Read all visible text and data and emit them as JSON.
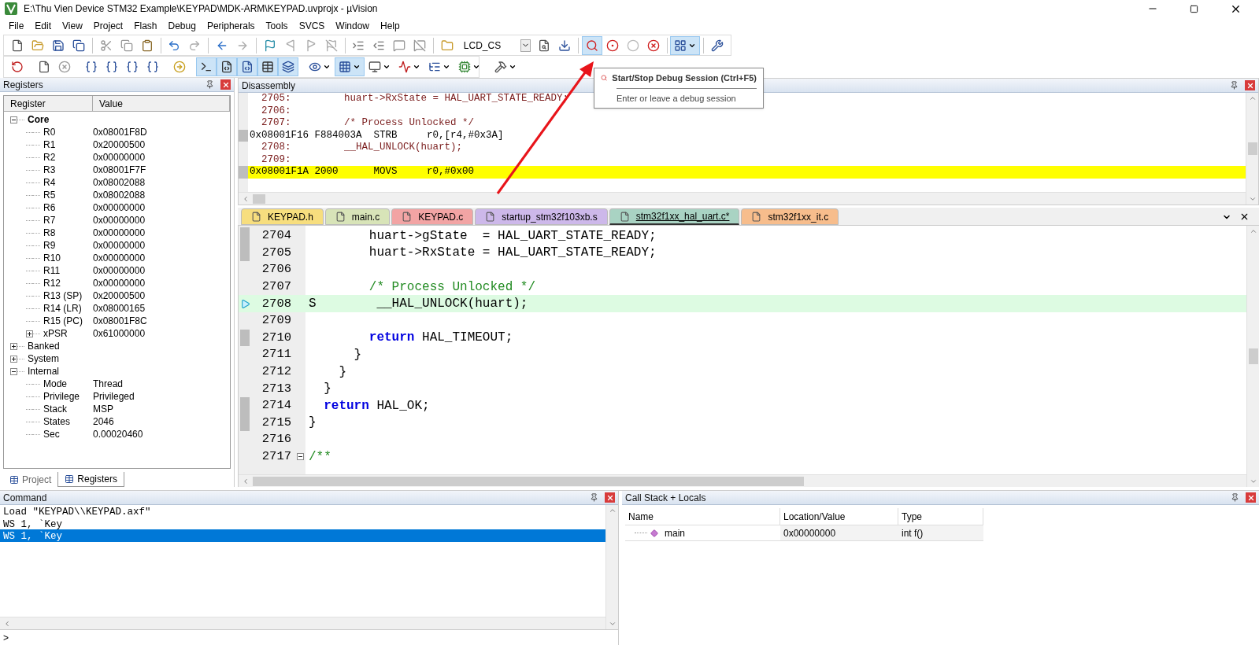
{
  "window": {
    "title": "E:\\Thu Vien Device STM32 Example\\KEYPAD\\MDK-ARM\\KEYPAD.uvprojx - µVision"
  },
  "menu": [
    "File",
    "Edit",
    "View",
    "Project",
    "Flash",
    "Debug",
    "Peripherals",
    "Tools",
    "SVCS",
    "Window",
    "Help"
  ],
  "toolbar_1": {
    "target": "LCD_CS",
    "buttons": [
      {
        "pressed": false
      },
      {
        "pressed": false
      },
      {
        "pressed": false
      },
      {
        "pressed": false
      },
      {
        "pressed": false
      },
      {
        "pressed": false
      },
      {
        "pressed": false
      },
      {
        "pressed": false
      },
      {
        "pressed": false
      },
      {
        "pressed": false
      },
      {
        "pressed": false
      },
      {
        "pressed": false
      },
      {
        "pressed": false
      },
      {
        "pressed": false
      },
      {
        "pressed": false
      },
      {
        "pressed": false
      },
      {
        "pressed": false
      },
      {
        "pressed": false
      },
      {
        "pressed": false
      },
      {
        "pressed": false
      },
      {
        "pressed": false
      },
      {
        "pressed": false
      },
      {
        "pressed": true
      },
      {
        "pressed": false
      },
      {
        "pressed": false
      },
      {
        "pressed": false
      },
      {
        "pressed": true
      },
      {
        "pressed": false
      }
    ]
  },
  "toolbar_2": {
    "buttons": [
      {
        "pressed": false
      },
      {
        "pressed": false
      },
      {
        "pressed": false
      },
      {
        "pressed": false
      },
      {
        "pressed": false
      },
      {
        "pressed": false
      },
      {
        "pressed": false
      },
      {
        "pressed": false
      },
      {
        "pressed": true
      },
      {
        "pressed": true
      },
      {
        "pressed": true
      },
      {
        "pressed": true
      },
      {
        "pressed": true
      },
      {
        "pressed": false
      },
      {
        "pressed": true
      },
      {
        "pressed": false
      },
      {
        "pressed": false
      },
      {
        "pressed": false
      },
      {
        "pressed": false
      },
      {
        "pressed": false
      }
    ]
  },
  "tooltip": {
    "title": "Start/Stop Debug Session (Ctrl+F5)",
    "description": "Enter or leave a debug session"
  },
  "registers": {
    "title": "Registers",
    "columns": [
      "Register",
      "Value"
    ],
    "tree": [
      {
        "name": "Core",
        "expanded": true,
        "bold": true,
        "children": [
          {
            "name": "R0",
            "value": "0x08001F8D"
          },
          {
            "name": "R1",
            "value": "0x20000500"
          },
          {
            "name": "R2",
            "value": "0x00000000"
          },
          {
            "name": "R3",
            "value": "0x08001F7F"
          },
          {
            "name": "R4",
            "value": "0x08002088"
          },
          {
            "name": "R5",
            "value": "0x08002088"
          },
          {
            "name": "R6",
            "value": "0x00000000"
          },
          {
            "name": "R7",
            "value": "0x00000000"
          },
          {
            "name": "R8",
            "value": "0x00000000"
          },
          {
            "name": "R9",
            "value": "0x00000000"
          },
          {
            "name": "R10",
            "value": "0x00000000"
          },
          {
            "name": "R11",
            "value": "0x00000000"
          },
          {
            "name": "R12",
            "value": "0x00000000"
          },
          {
            "name": "R13 (SP)",
            "value": "0x20000500"
          },
          {
            "name": "R14 (LR)",
            "value": "0x08000165"
          },
          {
            "name": "R15 (PC)",
            "value": "0x08001F8C"
          },
          {
            "name": "xPSR",
            "value": "0x61000000",
            "expanded": false
          }
        ]
      },
      {
        "name": "Banked",
        "expanded": false,
        "bold": false
      },
      {
        "name": "System",
        "expanded": false,
        "bold": false
      },
      {
        "name": "Internal",
        "expanded": true,
        "bold": false,
        "children": [
          {
            "name": "Mode",
            "value": "Thread"
          },
          {
            "name": "Privilege",
            "value": "Privileged"
          },
          {
            "name": "Stack",
            "value": "MSP"
          },
          {
            "name": "States",
            "value": "2046"
          },
          {
            "name": "Sec",
            "value": "0.00020460"
          }
        ]
      }
    ]
  },
  "left_tabs": [
    {
      "label": "Project",
      "selected": false
    },
    {
      "label": "Registers",
      "selected": true
    }
  ],
  "disassembly": {
    "title": "Disassembly",
    "lines": [
      {
        "kind": "source",
        "text": "  2705:         huart->RxState = HAL_UART_STATE_READY;",
        "highlighted": false
      },
      {
        "kind": "source",
        "text": "  2706:",
        "highlighted": false
      },
      {
        "kind": "source",
        "text": "  2707:         /* Process Unlocked */",
        "highlighted": false
      },
      {
        "kind": "asm",
        "text": "0x08001F16 F884003A  STRB     r0,[r4,#0x3A]",
        "highlighted": false
      },
      {
        "kind": "source",
        "text": "  2708:         __HAL_UNLOCK(huart);",
        "highlighted": false
      },
      {
        "kind": "source",
        "text": "  2709:",
        "highlighted": false
      },
      {
        "kind": "asm",
        "text": "0x08001F1A 2000      MOVS     r0,#0x00",
        "highlighted": true
      }
    ]
  },
  "editor_tabs": [
    {
      "label": "KEYPAD.h",
      "color": "#f7de7e",
      "selected": false
    },
    {
      "label": "main.c",
      "color": "#d8e4b8",
      "selected": false
    },
    {
      "label": "KEYPAD.c",
      "color": "#f2a4a4",
      "selected": false
    },
    {
      "label": "startup_stm32f103xb.s",
      "color": "#cdb8ea",
      "selected": false
    },
    {
      "label": "stm32f1xx_hal_uart.c*",
      "color": "#a9d3c3",
      "selected": true
    },
    {
      "label": "stm32f1xx_it.c",
      "color": "#f7bd8c",
      "selected": false
    }
  ],
  "editor": {
    "lines": [
      {
        "number": "2704",
        "executable": true,
        "current": false,
        "fold": false,
        "segments": [
          {
            "kind": "plain",
            "text": "        huart->gState  = HAL_UART_STATE_READY;"
          }
        ]
      },
      {
        "number": "2705",
        "executable": true,
        "current": false,
        "fold": false,
        "segments": [
          {
            "kind": "plain",
            "text": "        huart->RxState = HAL_UART_STATE_READY;"
          }
        ]
      },
      {
        "number": "2706",
        "executable": false,
        "current": false,
        "fold": false
      },
      {
        "number": "2707",
        "executable": false,
        "current": false,
        "fold": false,
        "segments": [
          {
            "kind": "comment",
            "text": "        /* Process Unlocked */"
          }
        ]
      },
      {
        "number": "2708",
        "executable": false,
        "current": true,
        "fold": false,
        "segments": [
          {
            "kind": "plain",
            "text": "S        __HAL_UNLOCK(huart);"
          }
        ]
      },
      {
        "number": "2709",
        "executable": false,
        "current": false,
        "fold": false
      },
      {
        "number": "2710",
        "executable": true,
        "current": false,
        "fold": false,
        "segments": [
          {
            "kind": "keyword",
            "text": "        return"
          },
          {
            "kind": "plain",
            "text": " HAL_TIMEOUT;"
          }
        ]
      },
      {
        "number": "2711",
        "executable": false,
        "current": false,
        "fold": false,
        "segments": [
          {
            "kind": "plain",
            "text": "      }"
          }
        ]
      },
      {
        "number": "2712",
        "executable": false,
        "current": false,
        "fold": false,
        "segments": [
          {
            "kind": "plain",
            "text": "    }"
          }
        ]
      },
      {
        "number": "2713",
        "executable": false,
        "current": false,
        "fold": false,
        "segments": [
          {
            "kind": "plain",
            "text": "  }"
          }
        ]
      },
      {
        "number": "2714",
        "executable": true,
        "current": false,
        "fold": false,
        "segments": [
          {
            "kind": "keyword",
            "text": "  return"
          },
          {
            "kind": "plain",
            "text": " HAL_OK;"
          }
        ]
      },
      {
        "number": "2715",
        "executable": true,
        "current": false,
        "fold": false,
        "segments": [
          {
            "kind": "plain",
            "text": "}"
          }
        ]
      },
      {
        "number": "2716",
        "executable": false,
        "current": false,
        "fold": false
      },
      {
        "number": "2717",
        "executable": false,
        "current": false,
        "fold": true,
        "segments": [
          {
            "kind": "comment",
            "text": "/**"
          }
        ]
      }
    ]
  },
  "command": {
    "title": "Command",
    "lines": [
      {
        "text": "Load \"KEYPAD\\\\KEYPAD.axf\"",
        "selected": false
      },
      {
        "text": "WS 1, `Key",
        "selected": false
      },
      {
        "text": "WS 1, `Key",
        "selected": true
      }
    ],
    "prompt": ">"
  },
  "call_stack": {
    "title": "Call Stack + Locals",
    "columns": [
      "Name",
      "Location/Value",
      "Type"
    ],
    "rows": [
      {
        "name": "main",
        "location": "0x00000000",
        "type": "int f()"
      }
    ]
  }
}
